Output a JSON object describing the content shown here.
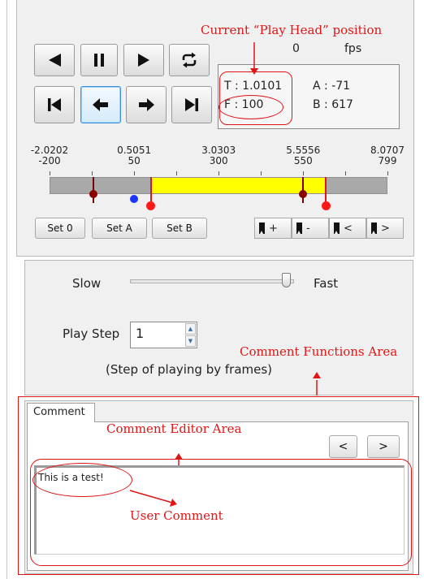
{
  "annotations": {
    "play_head": "Current “Play Head” position",
    "comment_functions": "Comment Functions Area",
    "comment_editor": "Comment Editor Area",
    "user_comment": "User Comment"
  },
  "transport": {
    "buttons": [
      "play-backward",
      "pause",
      "play-forward",
      "loop",
      "jump-to-start",
      "step-backward",
      "step-forward",
      "jump-to-end"
    ]
  },
  "fps": {
    "value": "0",
    "unit": "fps"
  },
  "position": {
    "t": "T : 1.0101",
    "f": "F : 100",
    "a": "A : -71",
    "b": "B : 617"
  },
  "timeline": {
    "times": [
      "-2.0202",
      "0.5051",
      "3.0303",
      "5.5556",
      "8.0707"
    ],
    "frames": [
      "-200",
      "50",
      "300",
      "550",
      "799"
    ],
    "frame_min": -200,
    "frame_max": 799,
    "highlight_start": 100,
    "highlight_end": 617,
    "zero_marker": 100,
    "marker_a": -71,
    "marker_b": 617,
    "bookmark_blue": 50,
    "bookmark_dark": [
      -71,
      550
    ]
  },
  "set_buttons": [
    "Set 0",
    "Set A",
    "Set B"
  ],
  "bookmark_buttons": [
    "+",
    "-",
    "<",
    ">"
  ],
  "speed": {
    "slow": "Slow",
    "fast": "Fast",
    "level": 0.96
  },
  "play_step": {
    "label": "Play Step",
    "value": "1",
    "hint": "(Step of playing by frames)"
  },
  "comment": {
    "tab": "Comment",
    "prev": "<",
    "next": ">",
    "text": "This is a test!"
  },
  "colors": {
    "annotation": "#e01515",
    "highlight": "#ffff00",
    "track": "#a9a9a9"
  }
}
